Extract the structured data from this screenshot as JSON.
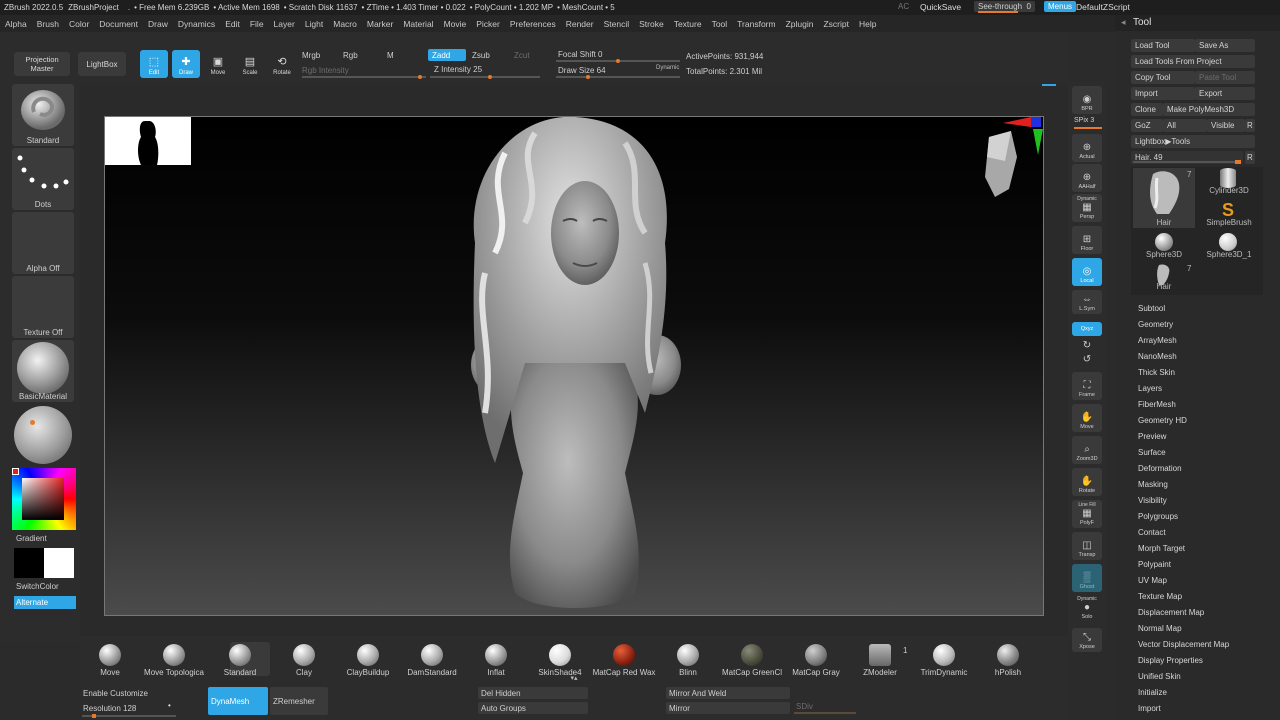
{
  "titlebar": {
    "app": "ZBrush 2022.0.5",
    "project": "ZBrushProject",
    "dot": ".",
    "free_mem": "• Free Mem 6.239GB",
    "active_mem": "• Active Mem 1698",
    "scratch": "• Scratch Disk 11637",
    "ztime": "• ZTime • 1.403 Timer • 0.022",
    "polycount": "• PolyCount • 1.202 MP",
    "meshcount": "• MeshCount • 5",
    "ac": "AC",
    "quicksave": "QuickSave",
    "seethrough": "See-through",
    "seethrough_val": "0",
    "menus": "Menus",
    "script": "DefaultZScript"
  },
  "menubar": [
    "Alpha",
    "Brush",
    "Color",
    "Document",
    "Draw",
    "Dynamics",
    "Edit",
    "File",
    "Layer",
    "Light",
    "Macro",
    "Marker",
    "Material",
    "Movie",
    "Picker",
    "Preferences",
    "Render",
    "Stencil",
    "Stroke",
    "Texture",
    "Tool",
    "Transform",
    "Zplugin",
    "Zscript",
    "Help"
  ],
  "topbar": {
    "projection_master_1": "Projection",
    "projection_master_2": "Master",
    "lightbox": "LightBox",
    "edit": "Edit",
    "draw": "Draw",
    "move": "Move",
    "scale": "Scale",
    "rotate": "Rotate",
    "mrgb": "Mrgb",
    "rgb": "Rgb",
    "m": "M",
    "rgb_intensity": "Rgb Intensity",
    "zadd": "Zadd",
    "zsub": "Zsub",
    "zcut": "Zcut",
    "z_intensity": "Z Intensity 25",
    "focal_shift": "Focal Shift 0",
    "draw_size": "Draw Size 64",
    "dynamic": "Dynamic",
    "active_points": "ActivePoints: 931,944",
    "total_points": "TotalPoints: 2.301 Mil"
  },
  "leftshelf": {
    "brush": "Standard",
    "stroke": "Dots",
    "alpha": "Alpha Off",
    "texture": "Texture Off",
    "material": "BasicMaterial",
    "gradient": "Gradient",
    "switchcolor": "SwitchColor",
    "alternate": "Alternate"
  },
  "rightbar": {
    "bpr": "BPR",
    "spix": "SPix 3",
    "actual": "Actual",
    "aahalf": "AAHalf",
    "dynamic": "Dynamic",
    "persp": "Persp",
    "floor": "Floor",
    "local": "Local",
    "lsym": "L.Sym",
    "xyz": "Qxyz",
    "frame": "Frame",
    "move": "Move",
    "zoom3d": "Zoom3D",
    "rotate": "Rotate",
    "linefill": "Line Fill",
    "polyf": "PolyF",
    "transp": "Transp",
    "ghost": "Ghost",
    "solo_dyn": "Dynamic",
    "solo": "Solo",
    "xpose": "Xpose"
  },
  "toolpanel": {
    "title": "Tool",
    "load_tool": "Load Tool",
    "save_as": "Save As",
    "load_from_project": "Load Tools From Project",
    "copy_tool": "Copy Tool",
    "paste_tool": "Paste Tool",
    "import": "Import",
    "export": "Export",
    "clone": "Clone",
    "make_polymesh": "Make PolyMesh3D",
    "goz": "GoZ",
    "all": "All",
    "visible": "Visible",
    "r": "R",
    "lightbox_tools": "Lightbox▶Tools",
    "hair_slider": "Hair. 49",
    "r2": "R",
    "thumbs": [
      {
        "label": "Hair",
        "count": "7"
      },
      {
        "label": "Cylinder3D"
      },
      {
        "label": "SimpleBrush"
      },
      {
        "label": "Sphere3D"
      },
      {
        "label": "Sphere3D_1"
      },
      {
        "label": "Hair",
        "count": "7"
      }
    ],
    "sections": [
      "Subtool",
      "Geometry",
      "ArrayMesh",
      "NanoMesh",
      "Thick Skin",
      "Layers",
      "FiberMesh",
      "Geometry HD",
      "Preview",
      "Surface",
      "Deformation",
      "Masking",
      "Visibility",
      "Polygroups",
      "Contact",
      "Morph Target",
      "Polypaint",
      "UV Map",
      "Texture Map",
      "Displacement Map",
      "Normal Map",
      "Vector Displacement Map",
      "Display Properties",
      "Unified Skin",
      "Initialize",
      "Import"
    ]
  },
  "bottomshelf": {
    "brushes": [
      "Move",
      "Move Topologica",
      "Standard",
      "Clay",
      "ClayBuildup",
      "DamStandard",
      "Inflat",
      "SkinShade4",
      "MatCap Red Wax",
      "Blinn",
      "MatCap GreenCl",
      "MatCap Gray",
      "ZModeler",
      "TrimDynamic",
      "hPolish"
    ],
    "zmodeler_count": "1"
  },
  "bottombar": {
    "enable_customize": "Enable Customize",
    "resolution": "Resolution 128",
    "dynamesh": "DynaMesh",
    "zremesher": "ZRemesher",
    "del_hidden": "Del Hidden",
    "auto_groups": "Auto Groups",
    "mirror_weld": "Mirror And Weld",
    "mirror": "Mirror",
    "sdiv": "SDiv"
  },
  "colors": {
    "accent": "#2fa7e6",
    "orange": "#e77a2a"
  }
}
